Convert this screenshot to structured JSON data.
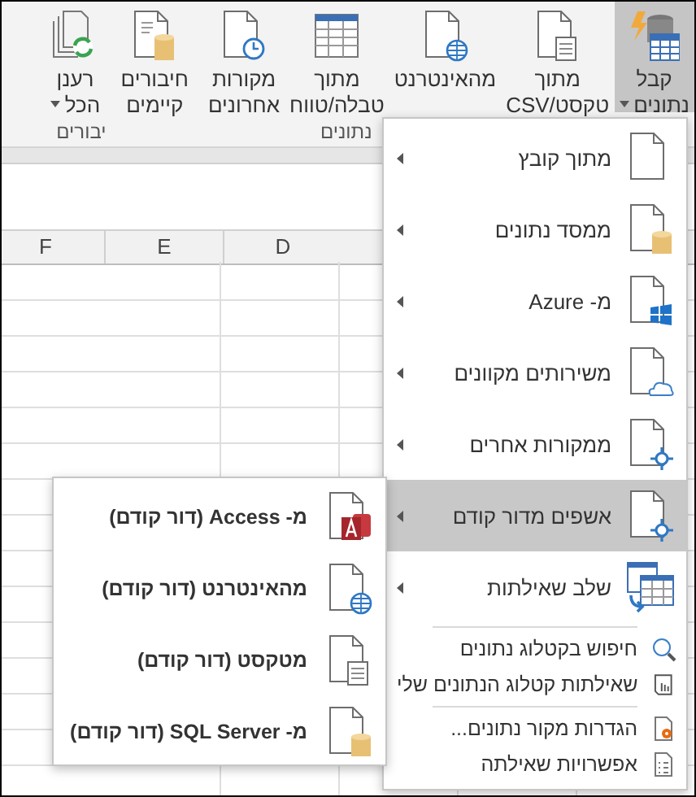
{
  "ribbon": {
    "groups": [
      {
        "label": "נתונים",
        "buttons": [
          {
            "kind": "get-data",
            "lines": [
              "קבל",
              "נתונים"
            ],
            "dropdown": true,
            "selected": true
          },
          {
            "kind": "text-csv",
            "lines": [
              "מתוך",
              "טקסט/CSV"
            ],
            "dropdown": false,
            "selected": false
          },
          {
            "kind": "web",
            "lines": [
              "מהאינטרנט"
            ],
            "dropdown": false,
            "selected": false
          },
          {
            "kind": "table",
            "lines": [
              "מתוך",
              "טבלה/טווח"
            ],
            "dropdown": false,
            "selected": false
          },
          {
            "kind": "recent",
            "lines": [
              "מקורות",
              "אחרונים"
            ],
            "dropdown": false,
            "selected": false
          }
        ]
      },
      {
        "buttons": [
          {
            "kind": "existing",
            "lines": [
              "חיבורים",
              "קיימים"
            ],
            "dropdown": false,
            "selected": false
          }
        ]
      },
      {
        "label": "יבורים",
        "buttons": [
          {
            "kind": "refresh",
            "lines": [
              "רענן",
              "הכל"
            ],
            "dropdown": true,
            "selected": false
          }
        ]
      }
    ]
  },
  "sheet": {
    "columns": [
      "D",
      "E",
      "F"
    ]
  },
  "menu": {
    "items": [
      {
        "kind": "large",
        "label": "מתוך קובץ",
        "submenu": true,
        "selected": false
      },
      {
        "kind": "large",
        "label": "ממסד נתונים",
        "submenu": true,
        "selected": false
      },
      {
        "kind": "large",
        "label": "מ- Azure",
        "submenu": true,
        "selected": false
      },
      {
        "kind": "large",
        "label": "משירותים מקוונים",
        "submenu": true,
        "selected": false
      },
      {
        "kind": "large",
        "label": "ממקורות אחרים",
        "submenu": true,
        "selected": false
      },
      {
        "kind": "large",
        "label": "אשפים מדור קודם",
        "submenu": true,
        "selected": true
      },
      {
        "kind": "large",
        "label": "שלב שאילתות",
        "submenu": true,
        "selected": false
      },
      {
        "kind": "separator"
      },
      {
        "kind": "small",
        "label": "חיפוש בקטלוג נתונים",
        "submenu": false,
        "selected": false
      },
      {
        "kind": "small",
        "label": "שאילתות קטלוג הנתונים שלי",
        "submenu": false,
        "selected": false
      },
      {
        "kind": "separator"
      },
      {
        "kind": "small",
        "label": "הגדרות מקור נתונים...",
        "submenu": false,
        "selected": false
      },
      {
        "kind": "small",
        "label": "אפשרויות שאילתה",
        "submenu": false,
        "selected": false
      }
    ]
  },
  "submenu": {
    "items": [
      {
        "label": "מ- Access (דור קודם)"
      },
      {
        "label": "מהאינטרנט (דור קודם)"
      },
      {
        "label": "מטקסט (דור קודם)"
      },
      {
        "label": "מ- SQL Server (דור קודם)"
      }
    ]
  }
}
